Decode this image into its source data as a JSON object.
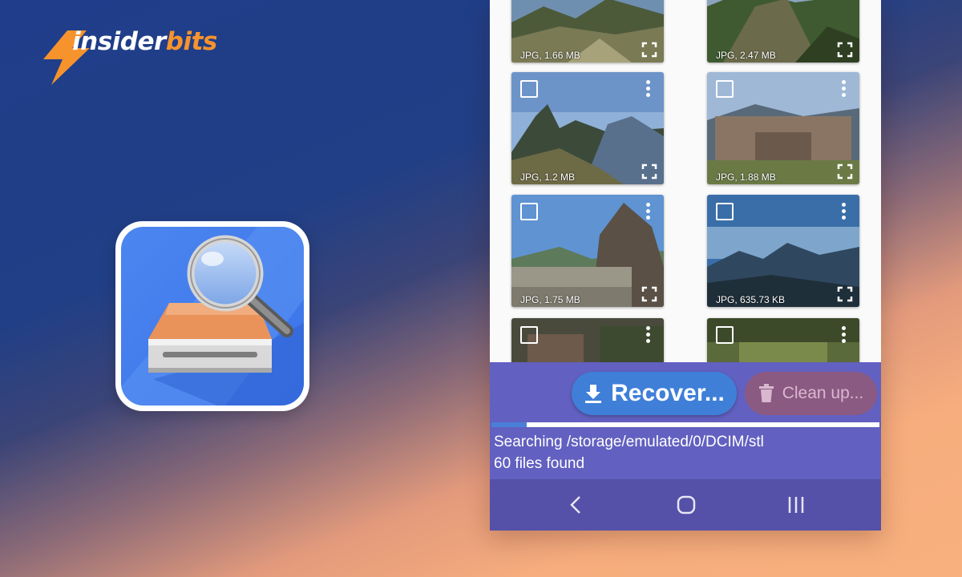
{
  "brand": {
    "name_part1": "insider",
    "name_part2": "bits"
  },
  "gallery": {
    "tiles": [
      {
        "caption": "JPG, 1.66 MB"
      },
      {
        "caption": "JPG, 2.47 MB"
      },
      {
        "caption": "JPG, 1.2 MB"
      },
      {
        "caption": "JPG, 1.88 MB"
      },
      {
        "caption": "JPG, 1.75 MB"
      },
      {
        "caption": "JPG, 635.73 KB"
      },
      {
        "caption": ""
      },
      {
        "caption": ""
      }
    ]
  },
  "actions": {
    "recover_label": "Recover...",
    "cleanup_label": "Clean up..."
  },
  "status": {
    "searching": "Searching /storage/emulated/0/DCIM/stl",
    "found": "60 files found",
    "progress_fraction": 0.09
  },
  "navbar": {
    "icons": [
      "back-icon",
      "home-icon",
      "recents-icon"
    ]
  },
  "colors": {
    "accent_blue": "#3f7fd8",
    "action_bar": "#6260c0",
    "cleanup_button": "#8b5a83",
    "brand_orange": "#f7932d"
  }
}
